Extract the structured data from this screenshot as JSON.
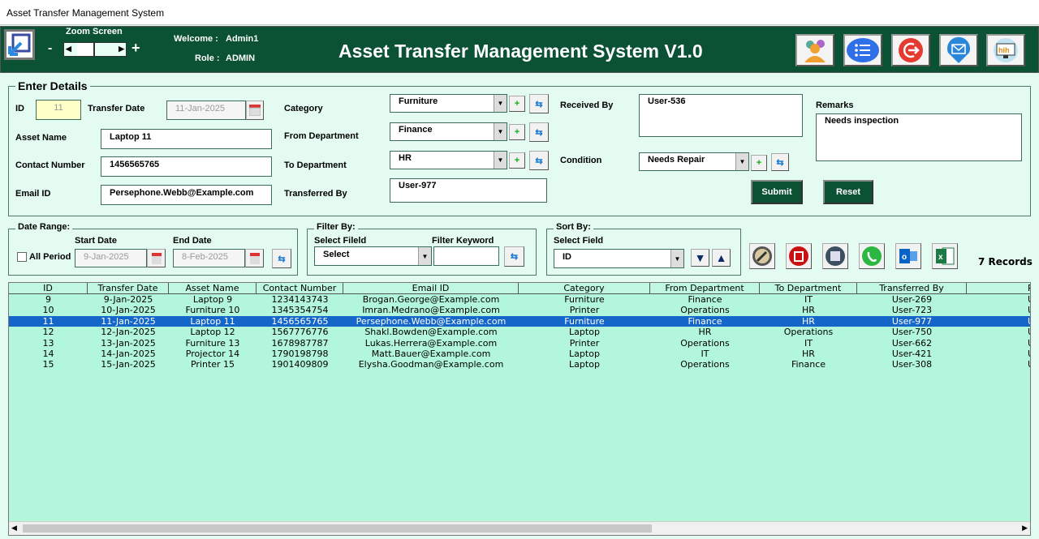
{
  "window_title": "Asset Transfer Management System",
  "header": {
    "zoom_label": "Zoom Screen",
    "zoom_minus": "-",
    "zoom_plus": "+",
    "welcome_label": "Welcome :",
    "welcome_value": "Admin1",
    "role_label": "Role :",
    "role_value": "ADMIN",
    "app_title": "Asset Transfer Management System V1.0",
    "icons": [
      "users-settings-icon",
      "list-icon",
      "logout-icon",
      "mail-icon",
      "monitor-icon"
    ]
  },
  "form": {
    "legend": "Enter Details",
    "id": {
      "label": "ID",
      "value": "11"
    },
    "transfer_date": {
      "label": "Transfer Date",
      "value": "11-Jan-2025"
    },
    "asset_name": {
      "label": "Asset Name",
      "value": "Laptop 11"
    },
    "contact_number": {
      "label": "Contact Number",
      "value": "1456565765"
    },
    "email": {
      "label": "Email ID",
      "value": "Persephone.Webb@Example.com"
    },
    "category": {
      "label": "Category",
      "value": "Furniture"
    },
    "from_department": {
      "label": "From Department",
      "value": "Finance"
    },
    "to_department": {
      "label": "To Department",
      "value": "HR"
    },
    "transferred_by": {
      "label": "Transferred By",
      "value": "User-977"
    },
    "received_by": {
      "label": "Received By",
      "value": "User-536"
    },
    "condition": {
      "label": "Condition",
      "value": "Needs Repair"
    },
    "remarks": {
      "label": "Remarks",
      "value": "Needs inspection"
    },
    "submit": "Submit",
    "reset": "Reset",
    "add": "+"
  },
  "date_range": {
    "legend": "Date Range:",
    "all_period": "All Period",
    "all_period_checked": false,
    "start_label": "Start Date",
    "start_value": "9-Jan-2025",
    "end_label": "End Date",
    "end_value": "8-Feb-2025"
  },
  "filter": {
    "legend": "Filter By:",
    "field_label": "Select Fileld",
    "field_value": "Select",
    "keyword_label": "Filter Keyword",
    "keyword_value": ""
  },
  "sort": {
    "legend": "Sort By:",
    "field_label": "Select Field",
    "field_value": "ID"
  },
  "toolbar": {
    "icons": [
      "edit-icon",
      "delete-icon",
      "print-icon",
      "whatsapp-icon",
      "outlook-icon",
      "excel-icon"
    ],
    "records": "7 Records"
  },
  "table": {
    "columns": [
      "ID",
      "Transfer Date",
      "Asset Name",
      "Contact Number",
      "Email ID",
      "Category",
      "From Department",
      "To Department",
      "Transferred By",
      "Rec"
    ],
    "rows": [
      [
        "9",
        "9-Jan-2025",
        "Laptop 9",
        "1234143743",
        "Brogan.George@Example.com",
        "Furniture",
        "Finance",
        "IT",
        "User-269",
        "Us"
      ],
      [
        "10",
        "10-Jan-2025",
        "Furniture 10",
        "1345354754",
        "Imran.Medrano@Example.com",
        "Printer",
        "Operations",
        "HR",
        "User-723",
        "Us"
      ],
      [
        "11",
        "11-Jan-2025",
        "Laptop 11",
        "1456565765",
        "Persephone.Webb@Example.com",
        "Furniture",
        "Finance",
        "HR",
        "User-977",
        "Us"
      ],
      [
        "12",
        "12-Jan-2025",
        "Laptop 12",
        "1567776776",
        "Shakl.Bowden@Example.com",
        "Laptop",
        "HR",
        "Operations",
        "User-750",
        "Us"
      ],
      [
        "13",
        "13-Jan-2025",
        "Furniture 13",
        "1678987787",
        "Lukas.Herrera@Example.com",
        "Printer",
        "Operations",
        "IT",
        "User-662",
        "Us"
      ],
      [
        "14",
        "14-Jan-2025",
        "Projector 14",
        "1790198798",
        "Matt.Bauer@Example.com",
        "Laptop",
        "IT",
        "HR",
        "User-421",
        "Us"
      ],
      [
        "15",
        "15-Jan-2025",
        "Printer 15",
        "1901409809",
        "Elysha.Goodman@Example.com",
        "Laptop",
        "Operations",
        "Finance",
        "User-308",
        "Us"
      ]
    ],
    "selected_index": 2
  },
  "colors": {
    "header_bg": "#0b5234",
    "selection": "#1466c8",
    "grid_bg": "#b2f7dc"
  }
}
